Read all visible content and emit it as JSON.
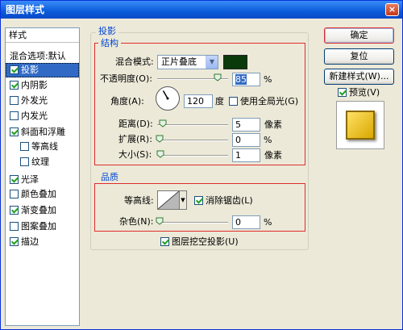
{
  "window": {
    "title": "图层样式",
    "close_label": "×"
  },
  "sidebar": {
    "header": "样式",
    "items": [
      {
        "label": "混合选项:默认",
        "checkbox": false,
        "checked": false,
        "selected": false,
        "indent": 0
      },
      {
        "label": "投影",
        "checkbox": true,
        "checked": true,
        "selected": true,
        "indent": 0
      },
      {
        "label": "内阴影",
        "checkbox": true,
        "checked": true,
        "selected": false,
        "indent": 0
      },
      {
        "label": "外发光",
        "checkbox": true,
        "checked": false,
        "selected": false,
        "indent": 0
      },
      {
        "label": "内发光",
        "checkbox": true,
        "checked": false,
        "selected": false,
        "indent": 0
      },
      {
        "label": "斜面和浮雕",
        "checkbox": true,
        "checked": true,
        "selected": false,
        "indent": 0
      },
      {
        "label": "等高线",
        "checkbox": true,
        "checked": false,
        "selected": false,
        "indent": 1
      },
      {
        "label": "纹理",
        "checkbox": true,
        "checked": false,
        "selected": false,
        "indent": 1
      },
      {
        "label": "光泽",
        "checkbox": true,
        "checked": true,
        "selected": false,
        "indent": 0
      },
      {
        "label": "颜色叠加",
        "checkbox": true,
        "checked": false,
        "selected": false,
        "indent": 0
      },
      {
        "label": "渐变叠加",
        "checkbox": true,
        "checked": true,
        "selected": false,
        "indent": 0
      },
      {
        "label": "图案叠加",
        "checkbox": true,
        "checked": false,
        "selected": false,
        "indent": 0
      },
      {
        "label": "描边",
        "checkbox": true,
        "checked": true,
        "selected": false,
        "indent": 0
      }
    ]
  },
  "drop_shadow": {
    "group_title": "投影",
    "structure": {
      "title": "结构",
      "blend_mode_label": "混合模式:",
      "blend_mode_value": "正片叠底",
      "shadow_color": "#0A3A0A",
      "opacity_label": "不透明度(O):",
      "opacity_value": "85",
      "opacity_unit": "%",
      "angle_label": "角度(A):",
      "angle_value": "120",
      "angle_unit": "度",
      "global_light_label": "使用全局光(G)",
      "global_light_checked": false,
      "distance_label": "距离(D):",
      "distance_value": "5",
      "distance_unit": "像素",
      "spread_label": "扩展(R):",
      "spread_value": "0",
      "spread_unit": "%",
      "size_label": "大小(S):",
      "size_value": "1",
      "size_unit": "像素"
    },
    "quality": {
      "title": "品质",
      "contour_label": "等高线:",
      "anti_alias_label": "消除锯齿(L)",
      "anti_alias_checked": true,
      "noise_label": "杂色(N):",
      "noise_value": "0",
      "noise_unit": "%"
    },
    "knockout_label": "图层挖空投影(U)",
    "knockout_checked": true
  },
  "buttons": {
    "ok": "确定",
    "reset": "复位",
    "new_style": "新建样式(W)...",
    "preview_label": "预览(V)",
    "preview_checked": true
  },
  "colors": {
    "accent": "#E02C2C",
    "selection": "#316AC5",
    "title_bar": "#0A5BDB",
    "dialog_bg": "#ECE9D8"
  }
}
